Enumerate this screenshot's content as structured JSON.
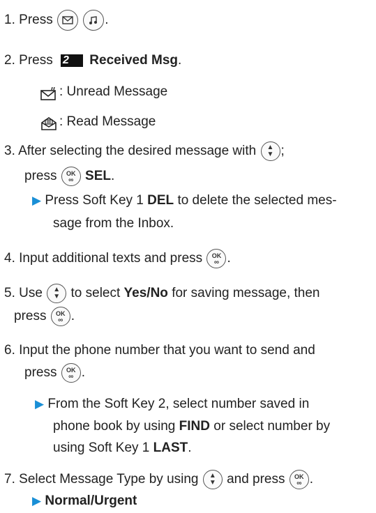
{
  "steps": {
    "s1": {
      "num": "1.",
      "text": "Press",
      "end": "."
    },
    "s2": {
      "num": "2.",
      "text": "Press",
      "key_label": "2",
      "label": "Received Msg",
      "end": "."
    },
    "unread": {
      "label": ": Unread Message"
    },
    "read": {
      "label": ": Read Message"
    },
    "s3": {
      "num": "3.",
      "text": "After selecting the desired message with",
      "end": ";",
      "press": "press",
      "sel": "SEL",
      "sel_end": "."
    },
    "s3_note": {
      "pre": "Press Soft Key 1",
      "bold": "DEL",
      "post": "to delete the selected mes-",
      "line2": "sage from the Inbox."
    },
    "s4": {
      "num": "4.",
      "text": "Input additional texts and press",
      "end": "."
    },
    "s5": {
      "num": "5.",
      "text1": "Use",
      "text2": "to select",
      "bold": "Yes/No",
      "text3": "for saving message, then",
      "press": "press",
      "end": "."
    },
    "s6": {
      "num": "6.",
      "text": "Input the phone number that you want to send and",
      "press": "press",
      "end": "."
    },
    "s6_note": {
      "l1": "From the Soft Key 2, select number saved in",
      "l2_pre": "phone book by using",
      "l2_bold": "FIND",
      "l2_post": "or select number by",
      "l3_pre": "using Soft Key 1",
      "l3_bold": "LAST",
      "l3_end": "."
    },
    "s7": {
      "num": "7.",
      "text1": "Select Message Type by using",
      "text2": "and press",
      "end": "."
    },
    "s7_note": {
      "bold": "Normal/Urgent"
    }
  },
  "icons": {
    "ok": "ok-button-icon",
    "nav": "navigation-key-icon",
    "msg": "message-key-icon",
    "menu": "menu-key-icon",
    "arrow": "bullet-arrow-icon",
    "accent": "#1a8fd6"
  }
}
